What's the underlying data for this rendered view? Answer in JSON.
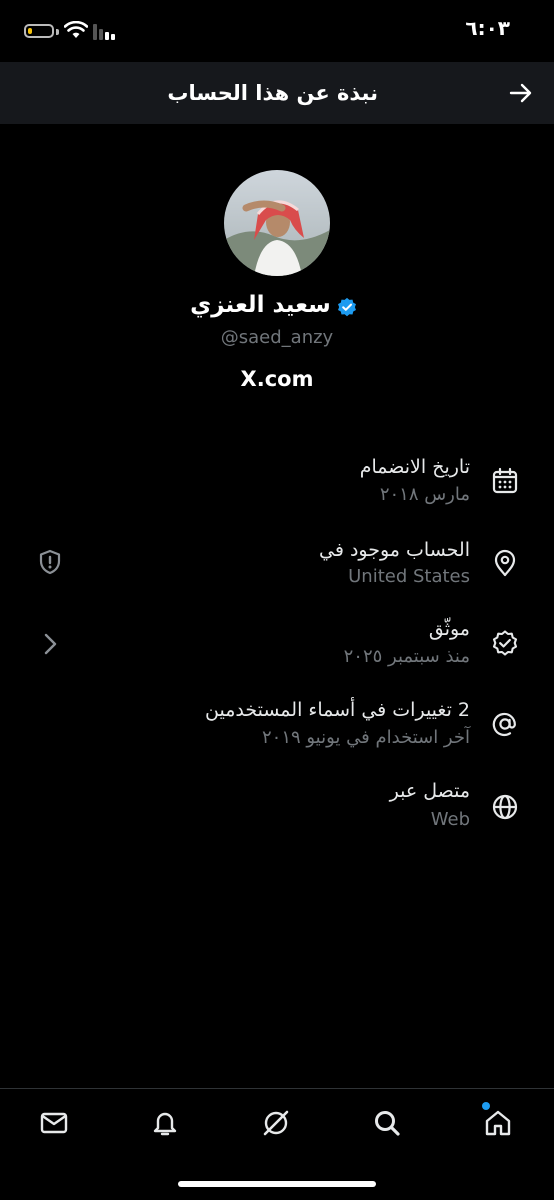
{
  "status_bar": {
    "time": "٦:٠٣",
    "battery_level": 0.2
  },
  "header": {
    "title": "نبذة عن هذا الحساب",
    "back_icon": "arrow-right-icon"
  },
  "profile": {
    "name": "سعيد العنزي",
    "handle": "@saed_anzy",
    "site": "X.com",
    "verified": true
  },
  "rows": [
    {
      "icon": "calendar-icon",
      "title": "تاريخ الانضمام",
      "subtitle": "مارس ٢٠١٨"
    },
    {
      "icon": "location-pin-icon",
      "title": "الحساب موجود في",
      "subtitle": "United States"
    },
    {
      "icon": "verified-check-icon",
      "title": "موثّق",
      "subtitle": "منذ سبتمبر ٢٠٢٥"
    },
    {
      "icon": "at-sign-icon",
      "title": "2 تغييرات في أسماء المستخدمين",
      "subtitle": "آخر استخدام في يونيو ٢٠١٩"
    },
    {
      "icon": "globe-icon",
      "title": "متصل عبر",
      "subtitle": "Web"
    }
  ],
  "colors": {
    "accent": "#1d9bf0",
    "header_bg": "#16181c",
    "secondary_text": "#71767b"
  },
  "bottom_nav": [
    "mail-icon",
    "bell-icon",
    "grok-icon",
    "search-icon",
    "home-icon"
  ]
}
